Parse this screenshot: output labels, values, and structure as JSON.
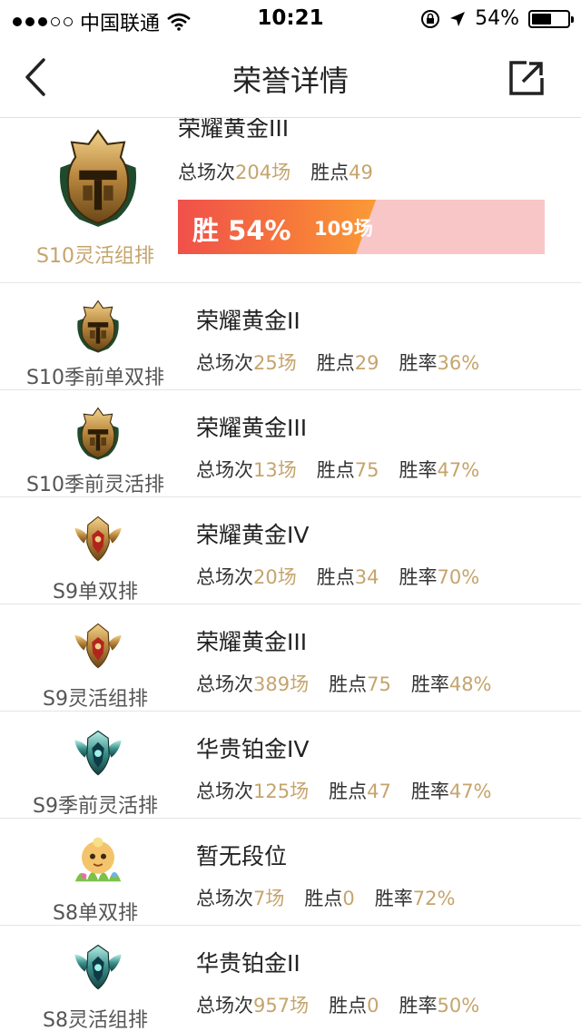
{
  "status_bar": {
    "carrier": "中国联通",
    "time": "10:21",
    "battery_text": "54%",
    "battery_level": 0.54
  },
  "nav": {
    "title": "荣誉详情",
    "back_icon": "chevron-left-icon",
    "share_icon": "share-external-icon"
  },
  "labels": {
    "total": "总场次",
    "points": "胜点",
    "winrate": "胜率"
  },
  "featured": {
    "tier": "荣耀黄金III",
    "mode": "S10灵活组排",
    "total_games": "204场",
    "points": "49",
    "win_label": "胜 54%",
    "win_games": "109场",
    "win_rate": 0.54
  },
  "records": [
    {
      "mode": "S10季前单双排",
      "tier": "荣耀黄金II",
      "total_games": "25场",
      "points": "29",
      "winrate": "36%",
      "badge": "gold-helmet"
    },
    {
      "mode": "S10季前灵活排",
      "tier": "荣耀黄金III",
      "total_games": "13场",
      "points": "75",
      "winrate": "47%",
      "badge": "gold-helmet"
    },
    {
      "mode": "S9单双排",
      "tier": "荣耀黄金IV",
      "total_games": "20场",
      "points": "34",
      "winrate": "70%",
      "badge": "gold-red-crest"
    },
    {
      "mode": "S9灵活组排",
      "tier": "荣耀黄金III",
      "total_games": "389场",
      "points": "75",
      "winrate": "48%",
      "badge": "gold-red-crest"
    },
    {
      "mode": "S9季前灵活排",
      "tier": "华贵铂金IV",
      "total_games": "125场",
      "points": "47",
      "winrate": "47%",
      "badge": "platinum-crest"
    },
    {
      "mode": "S8单双排",
      "tier": "暂无段位",
      "total_games": "7场",
      "points": "0",
      "winrate": "72%",
      "badge": "unranked-mascot"
    },
    {
      "mode": "S8灵活组排",
      "tier": "华贵铂金II",
      "total_games": "957场",
      "points": "0",
      "winrate": "50%",
      "badge": "platinum-crest"
    }
  ]
}
